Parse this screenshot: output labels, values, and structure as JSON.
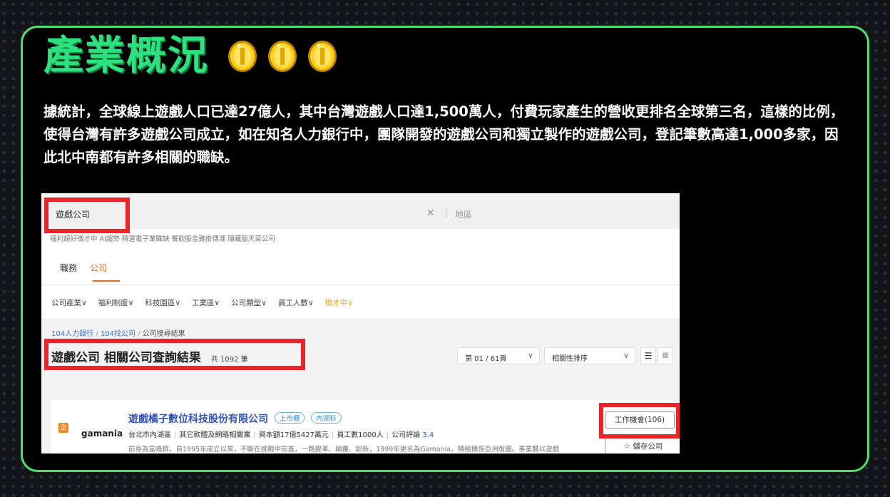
{
  "slide": {
    "title": "產業概況",
    "description": "據統計，全球線上遊戲人口已達27億人，其中台灣遊戲人口達1,500萬人，付費玩家產生的營收更排名全球第三名，這樣的比例，使得台灣有許多遊戲公司成立，如在知名人力銀行中，團隊開發的遊戲公司和獨立製作的遊戲公司，登記筆數高達1,000多家，因此北中南都有許多相關的職缺。",
    "accent_color": "#2fe07f",
    "border_color": "#4ee06a",
    "coin_icon": "gold-coin-icon"
  },
  "screenshot": {
    "search": {
      "query": "遊戲公司",
      "clear_symbol": "✕",
      "separator": "|",
      "area_placeholder": "地區"
    },
    "hot_keywords": "福利超好徵才中  AI趨勢  精選電子業職缺  餐飲股金雞掛傳潮  隱藏版天菜公司",
    "tabs": [
      "職務",
      "公司"
    ],
    "active_tab": "公司",
    "filters": [
      "公司產業∨",
      "福利制度∨",
      "科技園區∨",
      "工業區∨",
      "公司類型∨",
      "員工人數∨",
      "徵才中∨"
    ],
    "breadcrumb": {
      "home": "104人力銀行",
      "sep1": "/",
      "section": "104找公司",
      "sep2": "/",
      "current": "公司搜尋結果"
    },
    "result": {
      "title": "遊戲公司 相關公司查詢結果",
      "count": "共 1092 筆"
    },
    "pager": {
      "label": "第 01 / 61頁",
      "caret": "∨"
    },
    "sort": {
      "label": "相關性排序",
      "caret": "∨"
    },
    "view": {
      "list_symbol": "☰",
      "grid_symbol": "▦"
    },
    "company": {
      "badge": "企",
      "logo_text": "gamania",
      "name": "遊戲橘子數位科技股份有限公司",
      "tags": [
        "上市櫃",
        "內湖科"
      ],
      "location": "台北市內湖區",
      "industry": "其它軟體及網路相關業",
      "capital": "資本額17億5427萬元",
      "employees": "員工數1000人",
      "rating_label": "公司評論",
      "rating": "3.4",
      "desc": "前身為富峰群，自1995年成立以來，不斷在挑戰中前進，一路變革、顛覆、創新，1999年更名為Gamania，積極擴張亞洲版圖。事業體以遊戲為核心，延展到資訊、客服，支付、行銷等線上平台，多次推動台灣 Internet 時代成...",
      "jobs_button": "工作機會(106)",
      "save_button": "儲存公司",
      "save_icon": "star-outline-icon"
    },
    "highlight_color": "#e8262a"
  }
}
